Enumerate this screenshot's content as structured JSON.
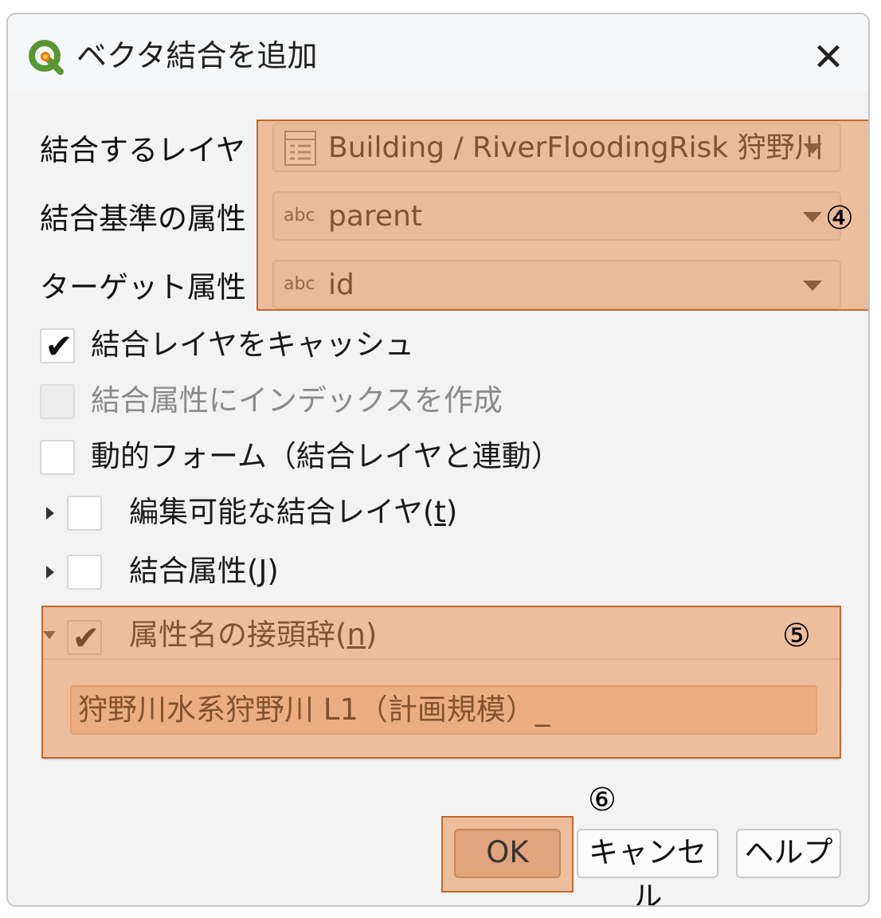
{
  "title": "ベクタ結合を追加",
  "close_glyph": "✕",
  "rows": {
    "join_layer": {
      "label": "結合するレイヤ",
      "value": "Building / RiverFloodingRisk 狩野川",
      "icon": "table-icon"
    },
    "join_field": {
      "label": "結合基準の属性",
      "type_tag": "abc",
      "value": "parent"
    },
    "target_field": {
      "label": "ターゲット属性",
      "type_tag": "abc",
      "value": "id"
    }
  },
  "options": {
    "cache": {
      "label": "結合レイヤをキャッシュ",
      "checked": true
    },
    "index": {
      "label": "結合属性にインデックスを作成",
      "checked": false,
      "disabled": true
    },
    "dynamic_form": {
      "label": "動的フォーム（結合レイヤと連動）",
      "checked": false
    }
  },
  "groups": {
    "editable": {
      "label_pre": "編集可能な結合レイヤ(",
      "mnemonic": "t",
      "label_post": ")",
      "checked": false,
      "expanded": false
    },
    "joined_fields": {
      "label_pre": "結合属性(",
      "mnemonic": "J",
      "label_post": ")",
      "checked": false,
      "expanded": false
    },
    "prefix": {
      "label_pre": "属性名の接頭辞(",
      "mnemonic": "n",
      "label_post": ")",
      "checked": true,
      "expanded": true,
      "value": "狩野川水系狩野川 L1（計画規模）_"
    }
  },
  "buttons": {
    "ok": "OK",
    "cancel": "キャンセル",
    "help": "ヘルプ"
  },
  "annotations": {
    "n4": "④",
    "n5": "⑤",
    "n6": "⑥"
  },
  "colors": {
    "highlight": "#e88a46",
    "highlight_border": "#c2692d",
    "qgis_green": "#589632",
    "qgis_yellow": "#ee7913"
  }
}
